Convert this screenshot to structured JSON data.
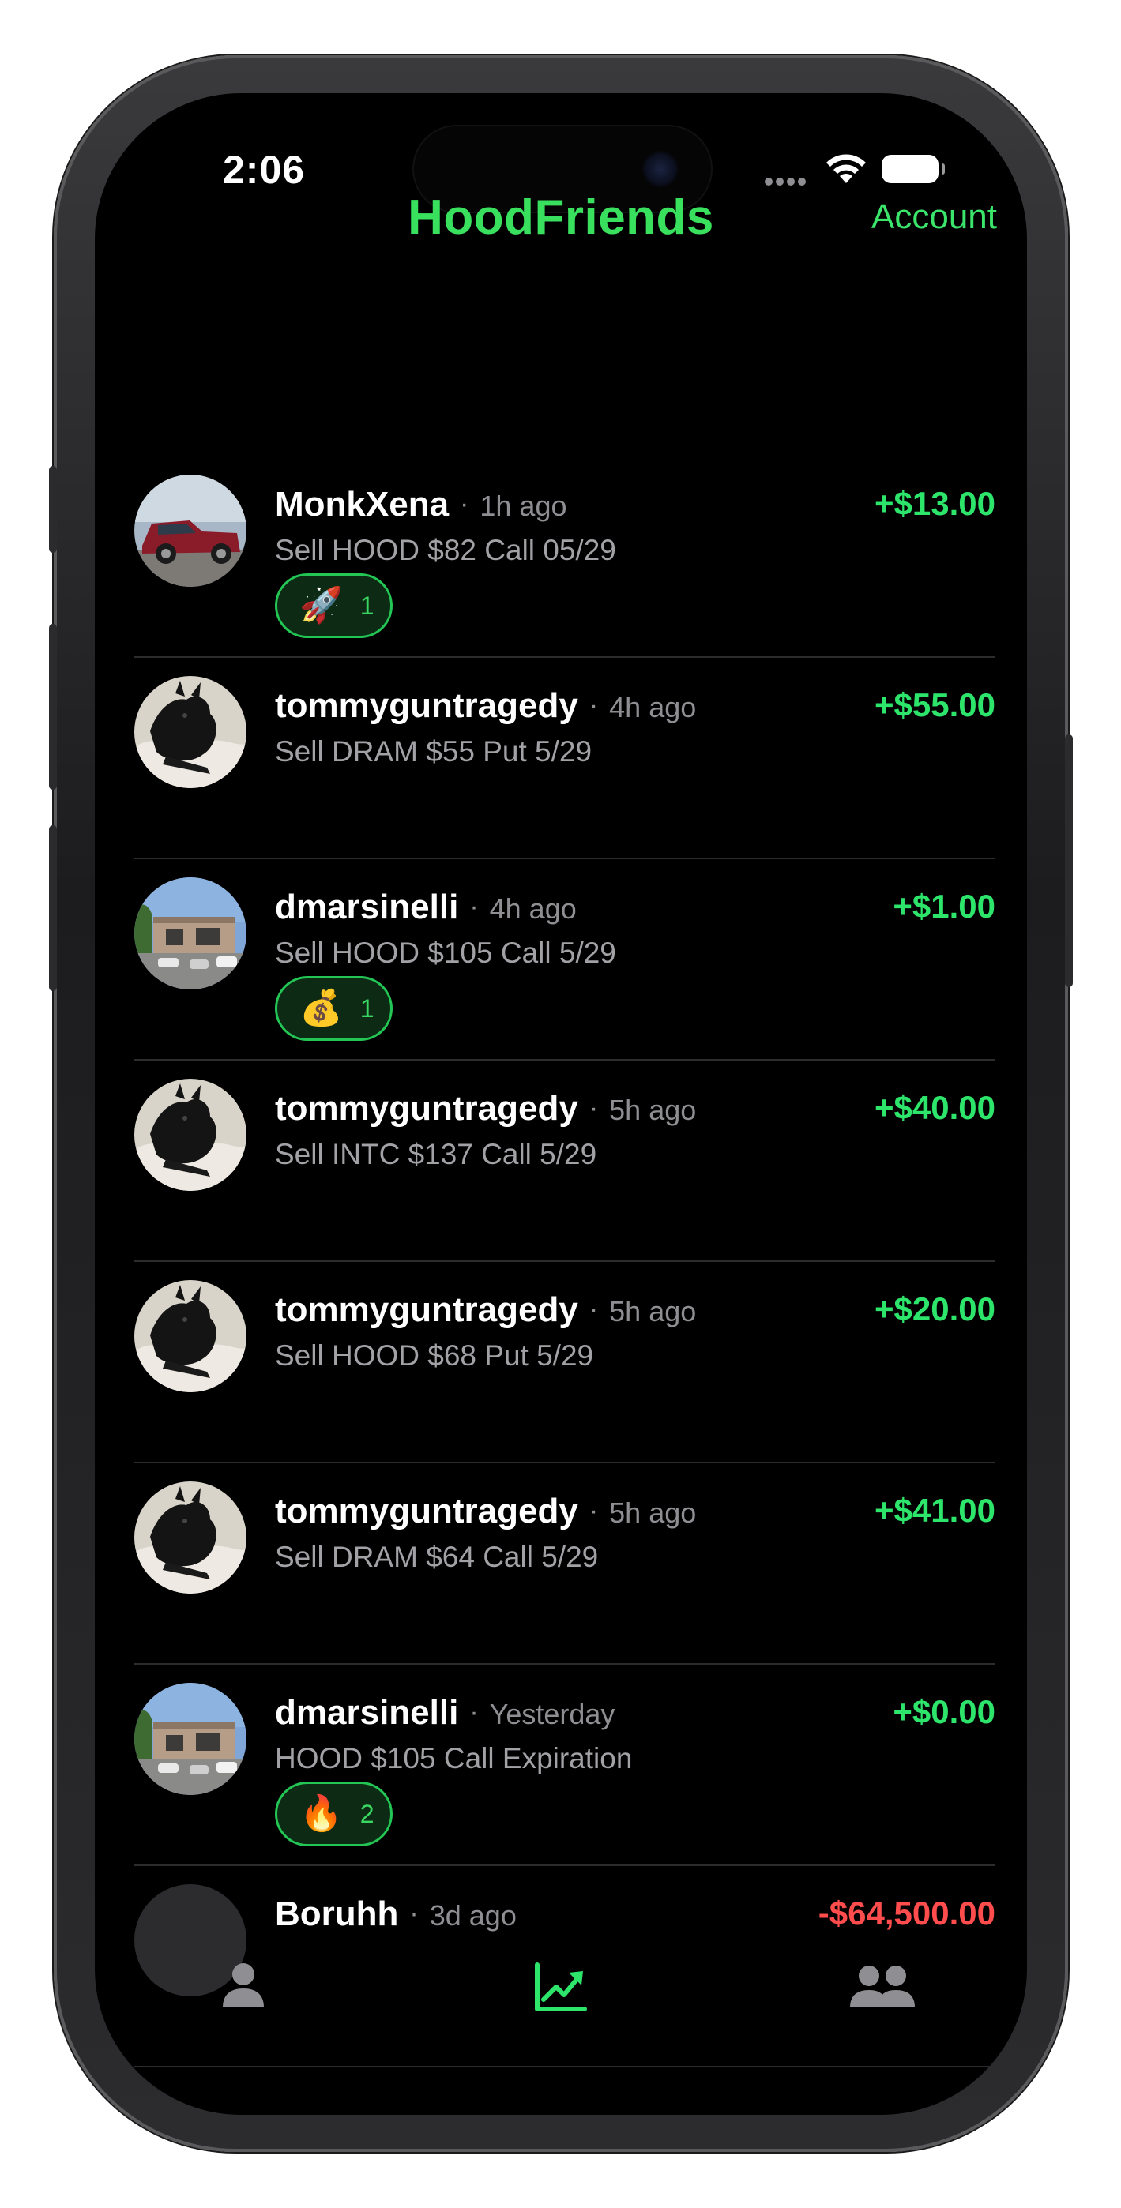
{
  "status_bar": {
    "time": "2:06"
  },
  "header": {
    "title": "HoodFriends",
    "account_label": "Account"
  },
  "feed": [
    {
      "user": "MonkXena",
      "time": "1h ago",
      "desc": "Sell HOOD $82 Call 05/29",
      "amount": "+$13.00",
      "sign": "pos",
      "avatar": "truck-photo",
      "reaction": {
        "emoji": "🚀",
        "icon": "rocket-icon",
        "count": "1"
      }
    },
    {
      "user": "tommyguntragedy",
      "time": "4h ago",
      "desc": "Sell DRAM $55 Put 5/29",
      "amount": "+$55.00",
      "sign": "pos",
      "avatar": "dog-photo"
    },
    {
      "user": "dmarsinelli",
      "time": "4h ago",
      "desc": "Sell HOOD $105 Call 5/29",
      "amount": "+$1.00",
      "sign": "pos",
      "avatar": "storefront-photo",
      "reaction": {
        "emoji": "💰",
        "icon": "money-bag-icon",
        "count": "1"
      }
    },
    {
      "user": "tommyguntragedy",
      "time": "5h ago",
      "desc": "Sell INTC $137 Call 5/29",
      "amount": "+$40.00",
      "sign": "pos",
      "avatar": "dog-photo"
    },
    {
      "user": "tommyguntragedy",
      "time": "5h ago",
      "desc": "Sell HOOD $68 Put 5/29",
      "amount": "+$20.00",
      "sign": "pos",
      "avatar": "dog-photo"
    },
    {
      "user": "tommyguntragedy",
      "time": "5h ago",
      "desc": "Sell DRAM $64 Call 5/29",
      "amount": "+$41.00",
      "sign": "pos",
      "avatar": "dog-photo"
    },
    {
      "user": "dmarsinelli",
      "time": "Yesterday",
      "desc": "HOOD $105 Call Expiration",
      "amount": "+$0.00",
      "sign": "pos",
      "avatar": "storefront-photo",
      "reaction": {
        "emoji": "🔥",
        "icon": "fire-icon",
        "count": "2"
      }
    },
    {
      "user": "Boruhh",
      "time": "3d ago",
      "desc": "",
      "amount": "-$64,500.00",
      "sign": "neg",
      "avatar": "placeholder"
    }
  ],
  "tabs": [
    {
      "name": "profile",
      "icon": "person-icon",
      "active": false
    },
    {
      "name": "feed",
      "icon": "chart-trend-icon",
      "active": true
    },
    {
      "name": "friends",
      "icon": "people-icon",
      "active": false
    }
  ],
  "colors": {
    "accent": "#39e05e",
    "positive": "#2ee56b",
    "negative": "#ff4d4d",
    "inactive_tab": "#8e8e93"
  }
}
